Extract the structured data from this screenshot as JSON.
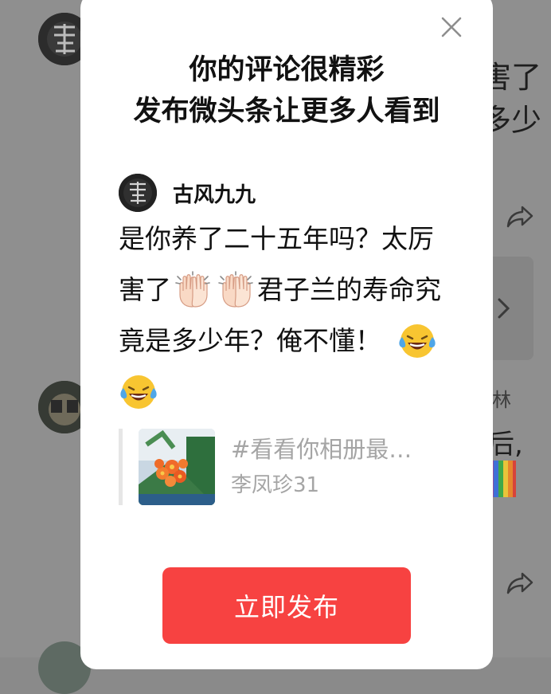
{
  "dialog": {
    "headline_line1": "你的评论很精彩",
    "headline_line2": "发布微头条让更多人看到",
    "close_icon": "close-icon"
  },
  "comment": {
    "author_name": "古风九九",
    "line1": "是你养了二十五年吗？太厉",
    "line2_a": "害了",
    "line2_b": "君子兰的寿命究",
    "line3": "竟是多少年？俺不懂！",
    "emojis": [
      "applause-icon",
      "applause-icon",
      "laughing-tears-icon",
      "laughing-tears-icon"
    ]
  },
  "quote": {
    "title": "#看看你相册最…",
    "author": "李凤珍31"
  },
  "actions": {
    "publish_label": "立即发布"
  },
  "background": {
    "text1": "害了",
    "text2": "多少",
    "text3": "林",
    "text4": "后,",
    "icons": [
      "share-icon",
      "chevron-right-icon",
      "rainbow-icon"
    ]
  },
  "colors": {
    "accent": "#f74241",
    "overlay": "#8f8f8f",
    "muted_text": "#a5a5a5"
  }
}
